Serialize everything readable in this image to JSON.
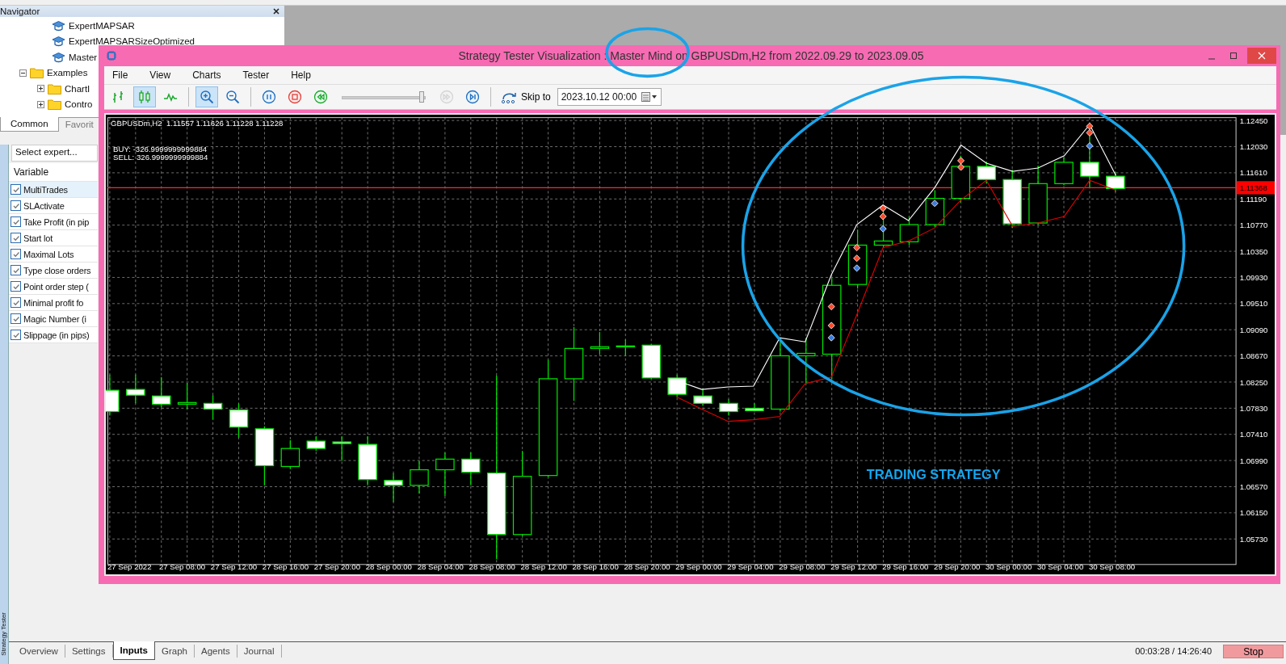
{
  "navigator": {
    "title": "Navigator",
    "tree": [
      {
        "label": "ExpertMAPSAR",
        "kind": "expert"
      },
      {
        "label": "ExpertMAPSARSizeOptimized",
        "kind": "expert"
      },
      {
        "label": "Master",
        "kind": "expert"
      },
      {
        "label": "Examples",
        "kind": "folder",
        "expanded": true,
        "children": [
          {
            "label": "ChartI",
            "kind": "folder",
            "expanded": false
          },
          {
            "label": "Contro",
            "kind": "folder",
            "expanded": false
          }
        ]
      }
    ],
    "tabs": [
      {
        "label": "Common",
        "selected": true
      },
      {
        "label": "Favorit",
        "selected": false
      }
    ]
  },
  "side_tab": "Strategy Tester",
  "tester": {
    "expert_select": {
      "placeholder": "Select expert..."
    },
    "column": "Variable",
    "rows": [
      {
        "name": "MultiTrades",
        "checked": true,
        "selected": true
      },
      {
        "name": "SLActivate",
        "checked": true,
        "selected": false
      },
      {
        "name": "Take Profit (in pip",
        "checked": true,
        "selected": false
      },
      {
        "name": "Start lot",
        "checked": true,
        "selected": false
      },
      {
        "name": "Maximal Lots",
        "checked": true,
        "selected": false
      },
      {
        "name": "Type close orders",
        "checked": true,
        "selected": false
      },
      {
        "name": "Point order step (",
        "checked": true,
        "selected": false
      },
      {
        "name": "Minimal profit fo",
        "checked": true,
        "selected": false
      },
      {
        "name": "Magic Number (i",
        "checked": true,
        "selected": false
      },
      {
        "name": "Slippage (in pips)",
        "checked": true,
        "selected": false
      }
    ],
    "tabs": [
      {
        "label": "Overview",
        "selected": false
      },
      {
        "label": "Settings",
        "selected": false
      },
      {
        "label": "Inputs",
        "selected": true
      },
      {
        "label": "Graph",
        "selected": false
      },
      {
        "label": "Agents",
        "selected": false
      },
      {
        "label": "Journal",
        "selected": false
      }
    ],
    "progress": "00:03:28 / 14:26:40",
    "stop_button": "Stop"
  },
  "window": {
    "title": "Strategy Tester Visualization : Master Mind on GBPUSDm,H2 from 2022.09.29 to 2023.09.05",
    "menu": [
      "File",
      "View",
      "Charts",
      "Tester",
      "Help"
    ],
    "toolbar": {
      "chart_modes": [
        {
          "kind": "bars",
          "selected": false
        },
        {
          "kind": "candles",
          "selected": true
        },
        {
          "kind": "line",
          "selected": false
        }
      ],
      "zoom": [
        {
          "kind": "zoom-in",
          "selected": true
        },
        {
          "kind": "zoom-out",
          "selected": false
        }
      ],
      "playback": [
        {
          "kind": "pause",
          "disabled": false
        },
        {
          "kind": "stop",
          "disabled": false
        },
        {
          "kind": "rewind",
          "disabled": false
        }
      ],
      "speed": {
        "level": 1
      },
      "stepping": [
        {
          "kind": "fast-forward",
          "disabled": true
        },
        {
          "kind": "step",
          "disabled": false
        }
      ],
      "skip_label": "Skip to",
      "skip_date": "2023.10.12 00:00"
    },
    "chart": {
      "info": "GBPUSDm,H2  1.11557 1.11626 1.11228 1.11228",
      "notes": [
        "BUY: -326.9999999999884",
        "SELL: 326.9999999999884"
      ],
      "price_labels": [
        "1.12450",
        "1.12030",
        "1.11610",
        "1.11190",
        "1.10770",
        "1.10350",
        "1.09930",
        "1.09510",
        "1.09090",
        "1.08670",
        "1.08250",
        "1.07830",
        "1.07410",
        "1.06990",
        "1.06570",
        "1.06150",
        "1.05730"
      ],
      "current_price": "1.11368",
      "time_labels": [
        "27 Sep 2022",
        "27 Sep 08:00",
        "27 Sep 12:00",
        "27 Sep 16:00",
        "27 Sep 20:00",
        "28 Sep 00:00",
        "28 Sep 04:00",
        "28 Sep 08:00",
        "28 Sep 12:00",
        "28 Sep 16:00",
        "28 Sep 20:00",
        "29 Sep 00:00",
        "29 Sep 04:00",
        "29 Sep 08:00",
        "29 Sep 12:00",
        "29 Sep 16:00",
        "29 Sep 20:00",
        "30 Sep 00:00",
        "30 Sep 04:00",
        "30 Sep 08:00"
      ]
    }
  },
  "annotation": {
    "text": "TRADING STRATEGY"
  }
}
